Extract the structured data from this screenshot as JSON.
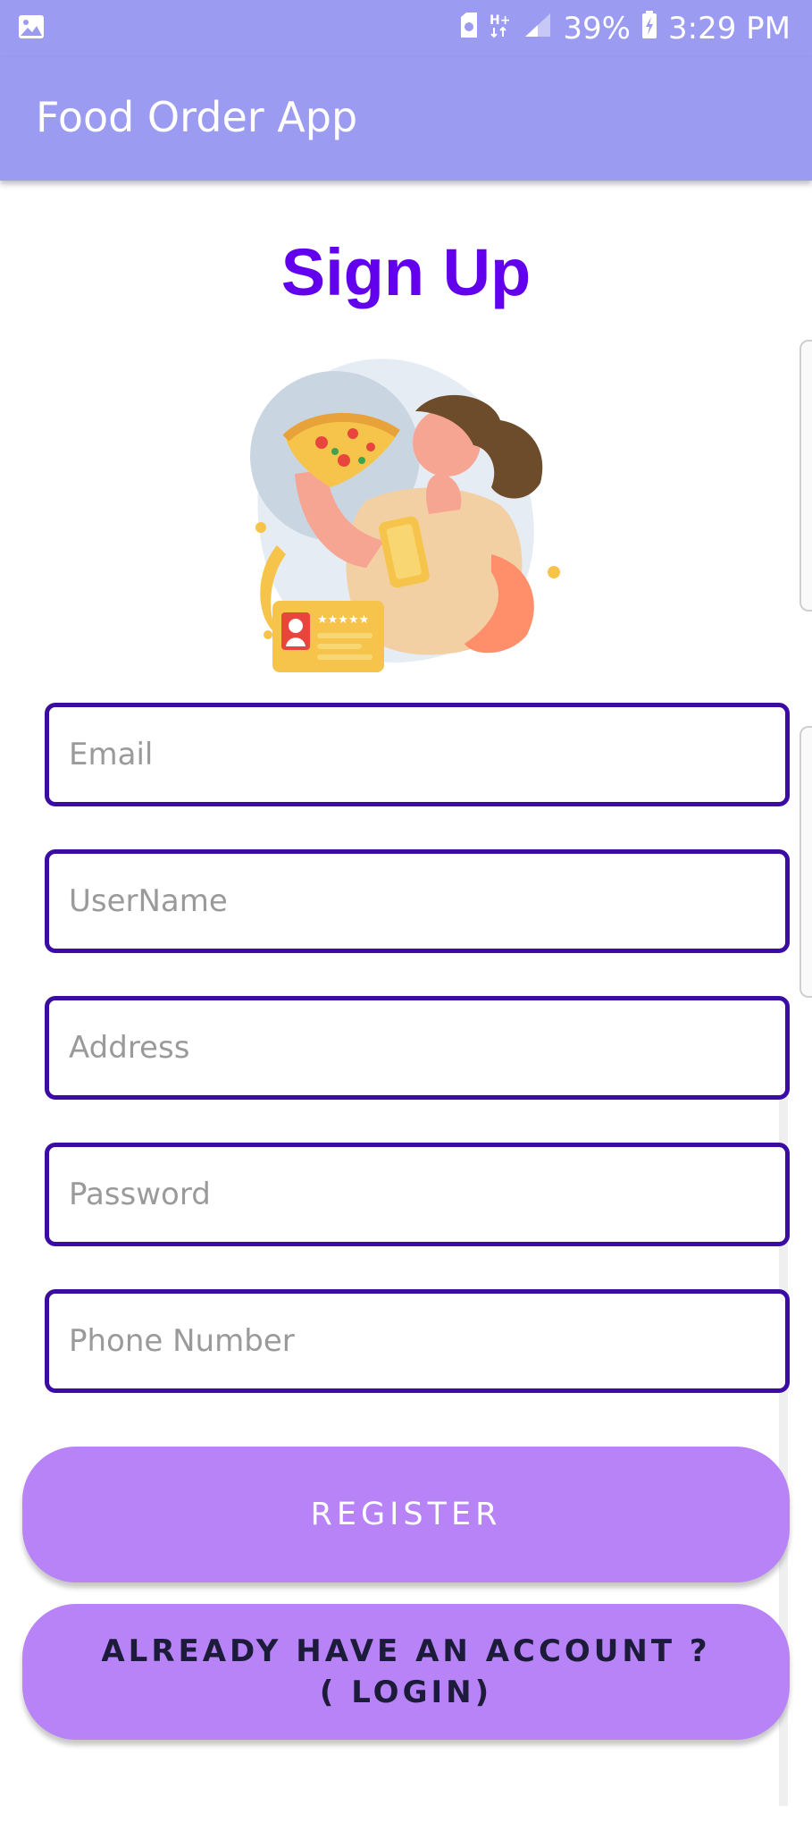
{
  "status_bar": {
    "battery": "39%",
    "time": "3:29 PM",
    "icons": [
      "image-icon",
      "sim-icon",
      "network-h-plus-icon",
      "signal-icon",
      "battery-charging-icon"
    ]
  },
  "app_bar": {
    "title": "Food Order App"
  },
  "page": {
    "title": "Sign Up"
  },
  "illustration": {
    "description_icon": "girl-eating-pizza-illustration"
  },
  "form": {
    "email": {
      "placeholder": "Email",
      "value": ""
    },
    "username": {
      "placeholder": "UserName",
      "value": ""
    },
    "address": {
      "placeholder": "Address",
      "value": ""
    },
    "password": {
      "placeholder": "Password",
      "value": ""
    },
    "phone": {
      "placeholder": "Phone Number",
      "value": ""
    }
  },
  "buttons": {
    "register": "REGISTER",
    "login": "ALREADY HAVE AN ACCOUNT ?\n( LOGIN)"
  },
  "colors": {
    "app_bar": "#9b9bf1",
    "title": "#6200ee",
    "field_border": "#3a0ca3",
    "button": "#b883f7"
  }
}
